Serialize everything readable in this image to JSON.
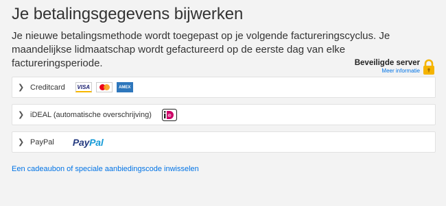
{
  "header": {
    "title": "Je betalingsgegevens bijwerken",
    "description": "Je nieuwe betalingsmethode wordt toegepast op je volgende factureringscyclus. Je maandelijkse lidmaatschap wordt gefactureerd op de eerste dag van elke factureringsperiode."
  },
  "secure": {
    "label": "Beveiligde server",
    "link": "Meer informatie",
    "icon": "lock-icon",
    "color": "#f5b400"
  },
  "payment_options": [
    {
      "label": "Creditcard",
      "logos": [
        "VISA",
        "AMEX"
      ]
    },
    {
      "label": "iDEAL (automatische overschrijving)",
      "logos": [
        "iD"
      ]
    },
    {
      "label": "PayPal",
      "logos": [
        "Pay",
        "Pal"
      ]
    }
  ],
  "voucher_link": "Een cadeaubon of speciale aanbiedingscode inwisselen",
  "colors": {
    "link": "#0073e6",
    "background": "#f3f3f3"
  }
}
